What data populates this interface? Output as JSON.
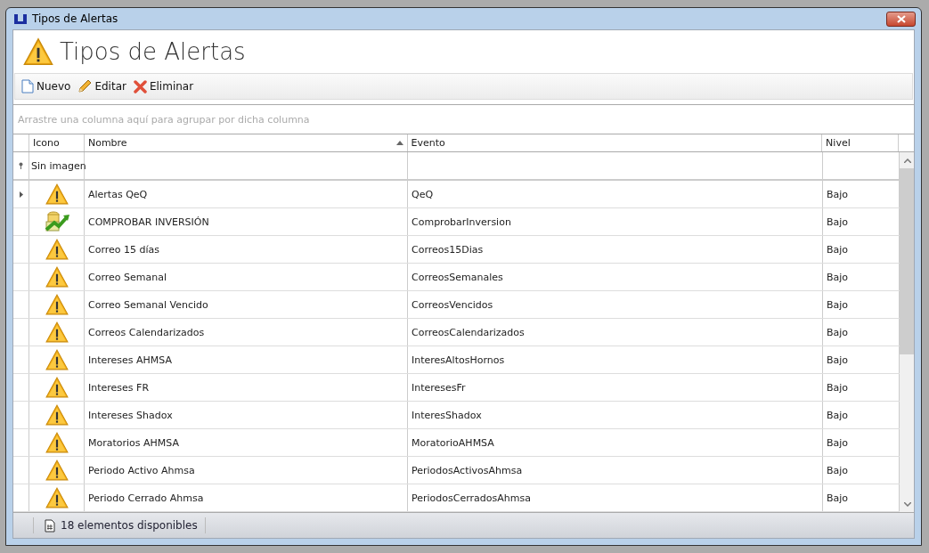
{
  "window": {
    "title": "Tipos de Alertas"
  },
  "header": {
    "title": "Tipos de Alertas"
  },
  "toolbar": [
    {
      "kind": "new",
      "label": "Nuevo"
    },
    {
      "kind": "edit",
      "label": "Editar"
    },
    {
      "kind": "delete",
      "label": "Eliminar"
    }
  ],
  "group_panel": {
    "placeholder": "Arrastre una columna aquí para agrupar por dicha columna"
  },
  "table": {
    "columns": [
      {
        "label": "Icono",
        "sorted": false
      },
      {
        "label": "Nombre",
        "sorted": true
      },
      {
        "label": "Evento",
        "sorted": false
      },
      {
        "label": "Nivel",
        "sorted": false
      }
    ],
    "filter_row": {
      "icon_filter": "Sin imagen"
    },
    "rows": [
      {
        "kind": "warning",
        "nombre": "Alertas QeQ",
        "evento": "QeQ",
        "nivel": "Bajo",
        "current": true
      },
      {
        "kind": "investment",
        "nombre": "COMPROBAR INVERSIÓN",
        "evento": "ComprobarInversion",
        "nivel": "Bajo",
        "current": false
      },
      {
        "kind": "warning",
        "nombre": "Correo 15 días",
        "evento": "Correos15Dias",
        "nivel": "Bajo",
        "current": false
      },
      {
        "kind": "warning",
        "nombre": "Correo Semanal",
        "evento": "CorreosSemanales",
        "nivel": "Bajo",
        "current": false
      },
      {
        "kind": "warning",
        "nombre": "Correo Semanal Vencido",
        "evento": "CorreosVencidos",
        "nivel": "Bajo",
        "current": false
      },
      {
        "kind": "warning",
        "nombre": "Correos Calendarizados",
        "evento": "CorreosCalendarizados",
        "nivel": "Bajo",
        "current": false
      },
      {
        "kind": "warning",
        "nombre": "Intereses AHMSA",
        "evento": "InteresAltosHornos",
        "nivel": "Bajo",
        "current": false
      },
      {
        "kind": "warning",
        "nombre": "Intereses FR",
        "evento": "InteresesFr",
        "nivel": "Bajo",
        "current": false
      },
      {
        "kind": "warning",
        "nombre": "Intereses Shadox",
        "evento": "InteresShadox",
        "nivel": "Bajo",
        "current": false
      },
      {
        "kind": "warning",
        "nombre": "Moratorios AHMSA",
        "evento": "MoratorioAHMSA",
        "nivel": "Bajo",
        "current": false
      },
      {
        "kind": "warning",
        "nombre": "Periodo Activo Ahmsa",
        "evento": "PeriodosActivosAhmsa",
        "nivel": "Bajo",
        "current": false
      },
      {
        "kind": "warning",
        "nombre": "Periodo Cerrado Ahmsa",
        "evento": "PeriodosCerradosAhmsa",
        "nivel": "Bajo",
        "current": false
      }
    ]
  },
  "status_bar": {
    "text": "18 elementos disponibles"
  }
}
